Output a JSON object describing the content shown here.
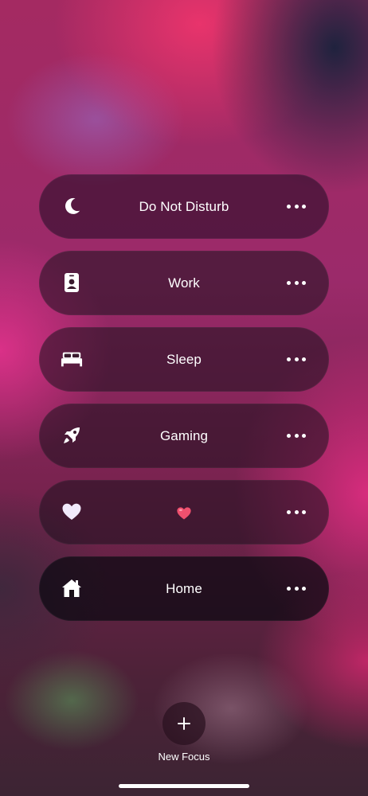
{
  "focus_modes": [
    {
      "label": "Do Not Disturb",
      "icon": "moon-icon"
    },
    {
      "label": "Work",
      "icon": "id-badge-icon"
    },
    {
      "label": "Sleep",
      "icon": "bed-icon"
    },
    {
      "label": "Gaming",
      "icon": "rocket-icon"
    },
    {
      "label": "❤️",
      "icon": "heart-icon"
    },
    {
      "label": "Home",
      "icon": "house-icon"
    }
  ],
  "new_focus": {
    "label": "New Focus",
    "icon": "plus-icon"
  },
  "colors": {
    "heart_emoji": "#f0506e",
    "row_text": "#ffffff"
  }
}
